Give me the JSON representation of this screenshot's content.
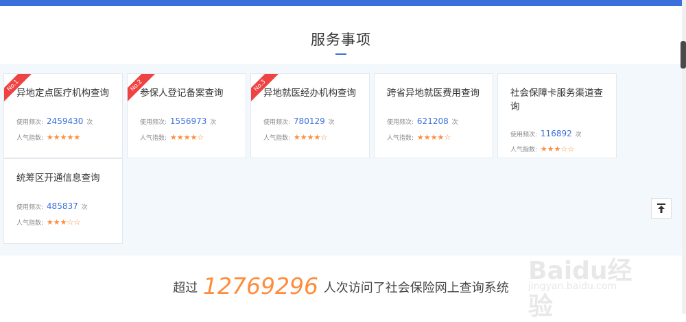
{
  "section": {
    "title": "服务事项"
  },
  "freq_label": "使用频次:",
  "freq_unit": "次",
  "pop_label": "人气指数:",
  "cards": [
    {
      "title": "异地定点医疗机构查询",
      "count": "2459430",
      "stars": "★★★★★",
      "rating": 5,
      "rank": "No.1"
    },
    {
      "title": "参保人登记备案查询",
      "count": "1556973",
      "stars": "★★★★☆",
      "rating": 4,
      "rank": "No.2"
    },
    {
      "title": "异地就医经办机构查询",
      "count": "780129",
      "stars": "★★★★☆",
      "rating": 4,
      "rank": "No.3"
    },
    {
      "title": "跨省异地就医费用查询",
      "count": "621208",
      "stars": "★★★★☆",
      "rating": 4
    },
    {
      "title": "社会保障卡服务渠道查询",
      "count": "116892",
      "stars": "★★★☆☆",
      "rating": 3
    },
    {
      "title": "统筹区开通信息查询",
      "count": "485837",
      "stars": "★★★☆☆",
      "rating": 3
    }
  ],
  "visits": {
    "prefix": "超过",
    "count": "12769296",
    "suffix": "人次访问了社会保险网上查询系统"
  },
  "watermark": {
    "brand": "Baidu经验",
    "url": "jingyan.baidu.com"
  },
  "icons": {
    "scroll_top": "arrow-up-to-top-icon"
  },
  "colors": {
    "accent": "#3b6fd9",
    "orange": "#ff8c3b",
    "ribbon": "#ef4343"
  }
}
